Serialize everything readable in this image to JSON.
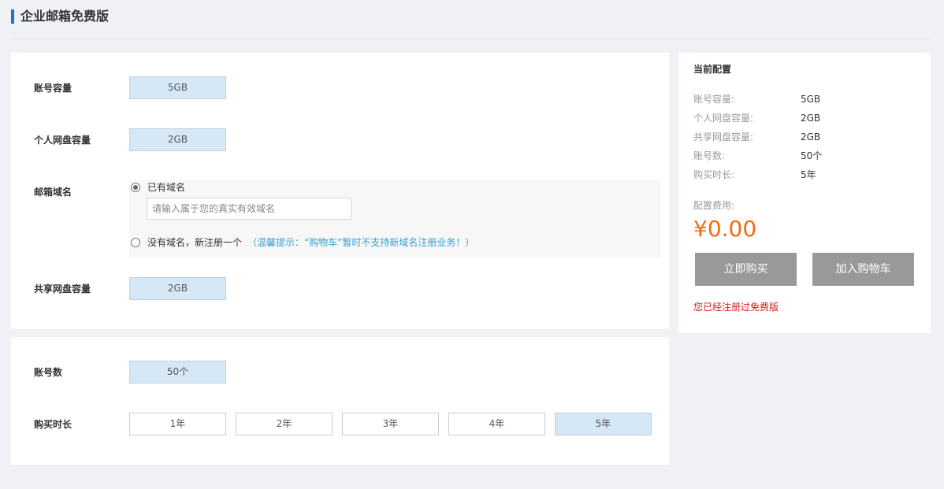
{
  "header": {
    "title": "企业邮箱免费版"
  },
  "config": {
    "account_capacity": {
      "label": "账号容量",
      "value": "5GB"
    },
    "personal_disk": {
      "label": "个人网盘容量",
      "value": "2GB"
    },
    "mail_domain": {
      "label": "邮箱域名",
      "has_domain_label": "已有域名",
      "domain_placeholder": "请输入属于您的真实有效域名",
      "no_domain_label": "没有域名，新注册一个",
      "hint": "（温馨提示：“购物车”暂时不支持新域名注册业务！）",
      "selected": "has_domain"
    },
    "shared_disk": {
      "label": "共享网盘容量",
      "value": "2GB"
    },
    "account_count": {
      "label": "账号数",
      "value": "50个"
    },
    "duration": {
      "label": "购买时长",
      "options": [
        "1年",
        "2年",
        "3年",
        "4年",
        "5年"
      ],
      "selected": "5年"
    }
  },
  "summary": {
    "title": "当前配置",
    "items": [
      {
        "label": "账号容量:",
        "value": "5GB"
      },
      {
        "label": "个人网盘容量:",
        "value": "2GB"
      },
      {
        "label": "共享网盘容量:",
        "value": "2GB"
      },
      {
        "label": "账号数:",
        "value": "50个"
      },
      {
        "label": "购买时长:",
        "value": "5年"
      }
    ],
    "fee_label": "配置费用:",
    "price": "¥0.00",
    "buy_now": "立即购买",
    "add_cart": "加入购物车",
    "notice": "您已经注册过免费版"
  },
  "colors": {
    "accent_bar": "#1a73d9",
    "price": "#f36a13",
    "notice": "#d21f1f",
    "hint": "#3aa0d0",
    "selected_chip": "#d6e7f6",
    "button_bg": "#999999"
  }
}
